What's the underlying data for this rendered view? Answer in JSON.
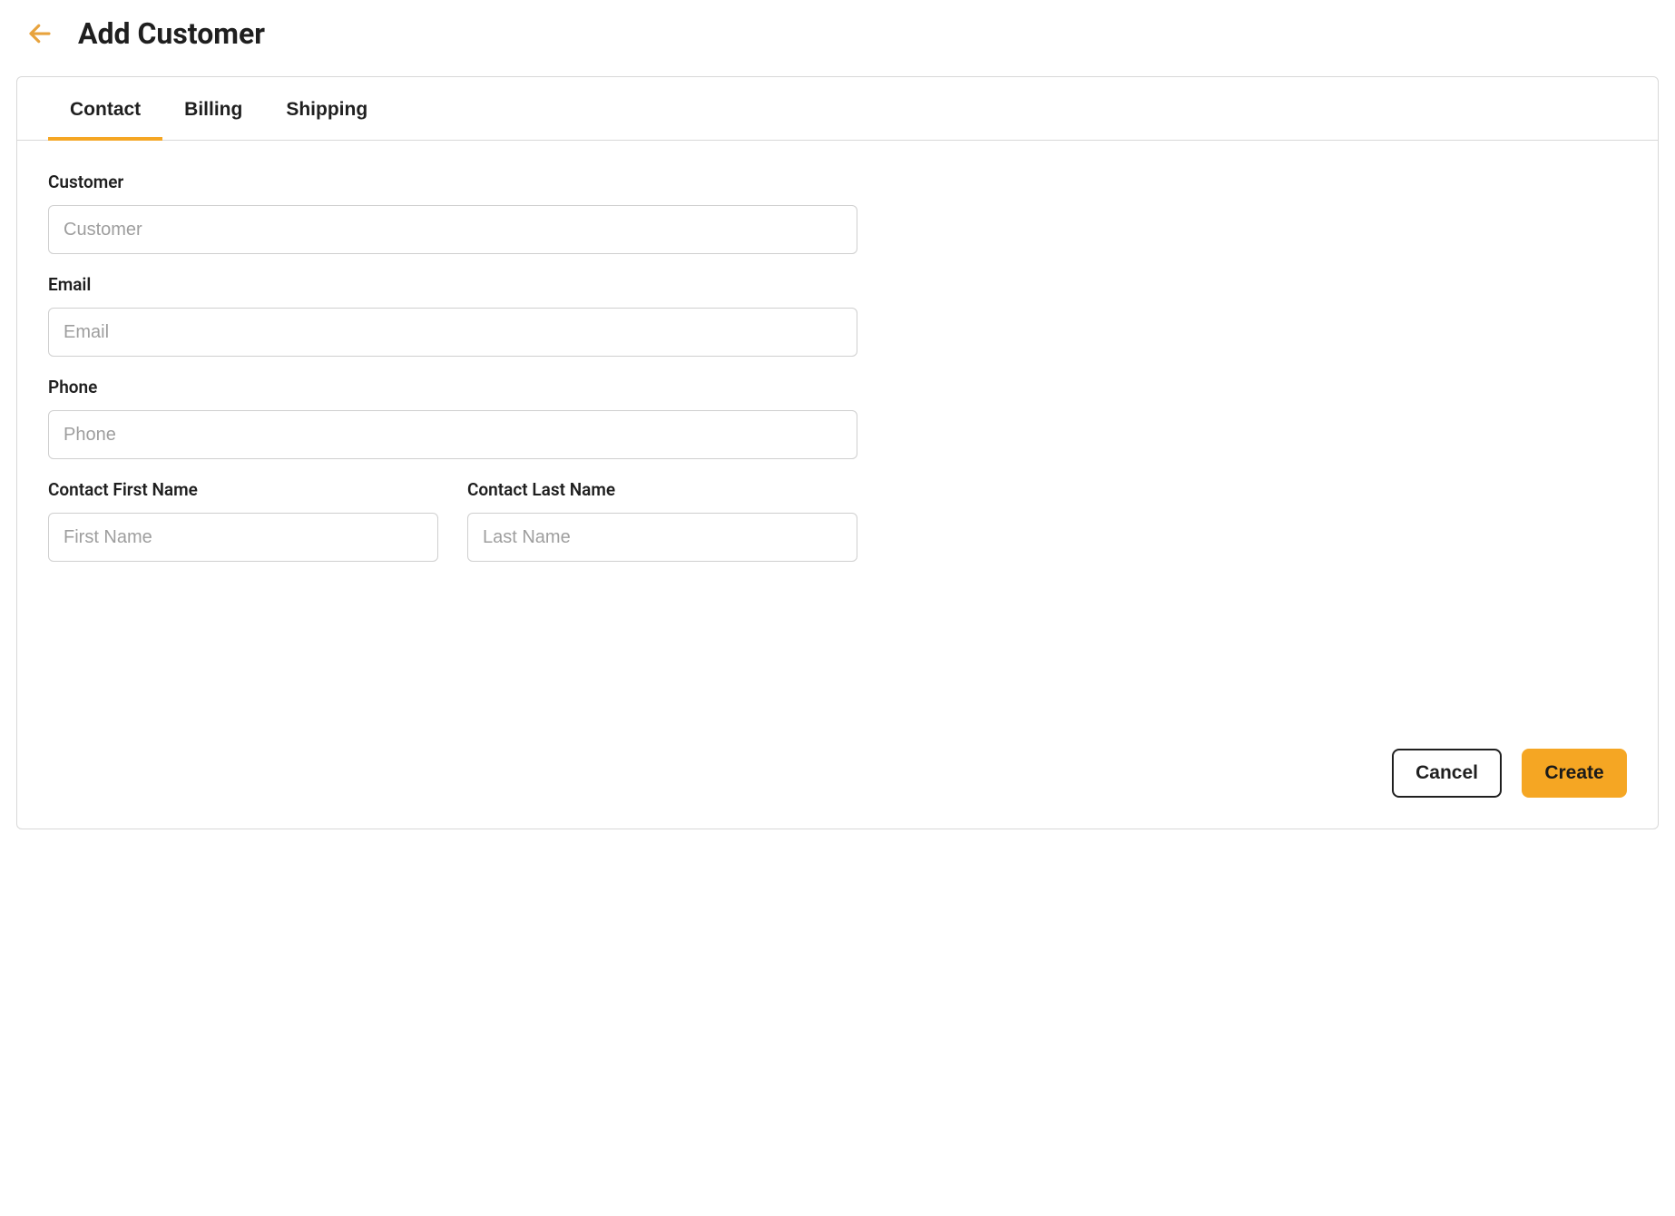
{
  "header": {
    "title": "Add Customer"
  },
  "tabs": {
    "contact": "Contact",
    "billing": "Billing",
    "shipping": "Shipping",
    "active": "contact"
  },
  "form": {
    "customer": {
      "label": "Customer",
      "placeholder": "Customer",
      "value": ""
    },
    "email": {
      "label": "Email",
      "placeholder": "Email",
      "value": ""
    },
    "phone": {
      "label": "Phone",
      "placeholder": "Phone",
      "value": ""
    },
    "firstName": {
      "label": "Contact First Name",
      "placeholder": "First Name",
      "value": ""
    },
    "lastName": {
      "label": "Contact Last Name",
      "placeholder": "Last Name",
      "value": ""
    }
  },
  "actions": {
    "cancel": "Cancel",
    "create": "Create"
  },
  "colors": {
    "accent": "#f5a623",
    "border": "#d8d8d8",
    "text": "#1f1f1f",
    "placeholder": "#9e9e9e"
  }
}
